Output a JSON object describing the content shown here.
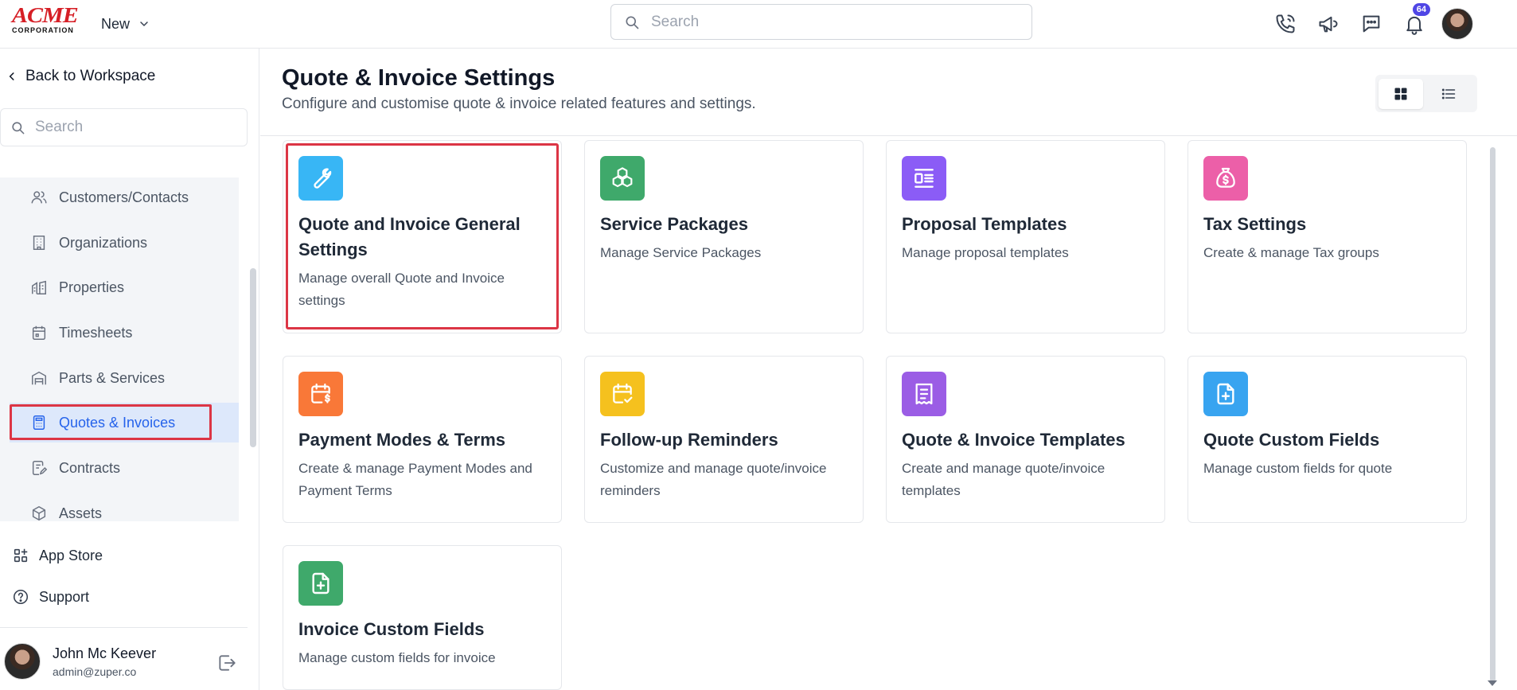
{
  "header": {
    "logo_text": "ACME",
    "logo_subtext": "CORPORATION",
    "new_label": "New",
    "search_placeholder": "Search",
    "notification_count": "64"
  },
  "sidebar": {
    "back_label": "Back to Workspace",
    "search_placeholder": "Search",
    "items": [
      {
        "label": "Customers/Contacts",
        "icon": "users-icon"
      },
      {
        "label": "Organizations",
        "icon": "building-icon"
      },
      {
        "label": "Properties",
        "icon": "properties-icon"
      },
      {
        "label": "Timesheets",
        "icon": "calendar-icon"
      },
      {
        "label": "Parts & Services",
        "icon": "warehouse-icon"
      },
      {
        "label": "Quotes & Invoices",
        "icon": "calculator-icon",
        "active": true
      },
      {
        "label": "Contracts",
        "icon": "contract-icon"
      },
      {
        "label": "Assets",
        "icon": "cube-icon"
      }
    ],
    "app_store_label": "App Store",
    "support_label": "Support",
    "user": {
      "name": "John Mc Keever",
      "email": "admin@zuper.co"
    }
  },
  "main": {
    "title": "Quote & Invoice Settings",
    "subtitle": "Configure and customise quote & invoice related features and settings.",
    "cards": [
      {
        "title": "Quote and Invoice General Settings",
        "desc": "Manage overall Quote and Invoice settings",
        "icon": "wrench-icon",
        "color": "#38b6f5",
        "selected": true
      },
      {
        "title": "Service Packages",
        "desc": "Manage Service Packages",
        "icon": "boxes-icon",
        "color": "#3fa96b"
      },
      {
        "title": "Proposal Templates",
        "desc": "Manage proposal templates",
        "icon": "layout-icon",
        "color": "#8b5cf6"
      },
      {
        "title": "Tax Settings",
        "desc": "Create & manage Tax groups",
        "icon": "money-bag-icon",
        "color": "#ec5fa8"
      },
      {
        "title": "Payment Modes & Terms",
        "desc": "Create & manage Payment Modes and Payment Terms",
        "icon": "calendar-dollar-icon",
        "color": "#f97838"
      },
      {
        "title": "Follow-up Reminders",
        "desc": "Customize and manage quote/invoice reminders",
        "icon": "calendar-check-icon",
        "color": "#f5c11e"
      },
      {
        "title": "Quote & Invoice Templates",
        "desc": "Create and manage quote/invoice templates",
        "icon": "receipt-icon",
        "color": "#9b5de5"
      },
      {
        "title": "Quote Custom Fields",
        "desc": "Manage custom fields for quote",
        "icon": "file-plus-icon",
        "color": "#38a4f0"
      },
      {
        "title": "Invoice Custom Fields",
        "desc": "Manage custom fields for invoice",
        "icon": "file-plus-icon",
        "color": "#3fa96b"
      }
    ]
  },
  "colors": {
    "accent": "#2563eb",
    "highlight": "#dc3545",
    "badge": "#4f46e5"
  }
}
